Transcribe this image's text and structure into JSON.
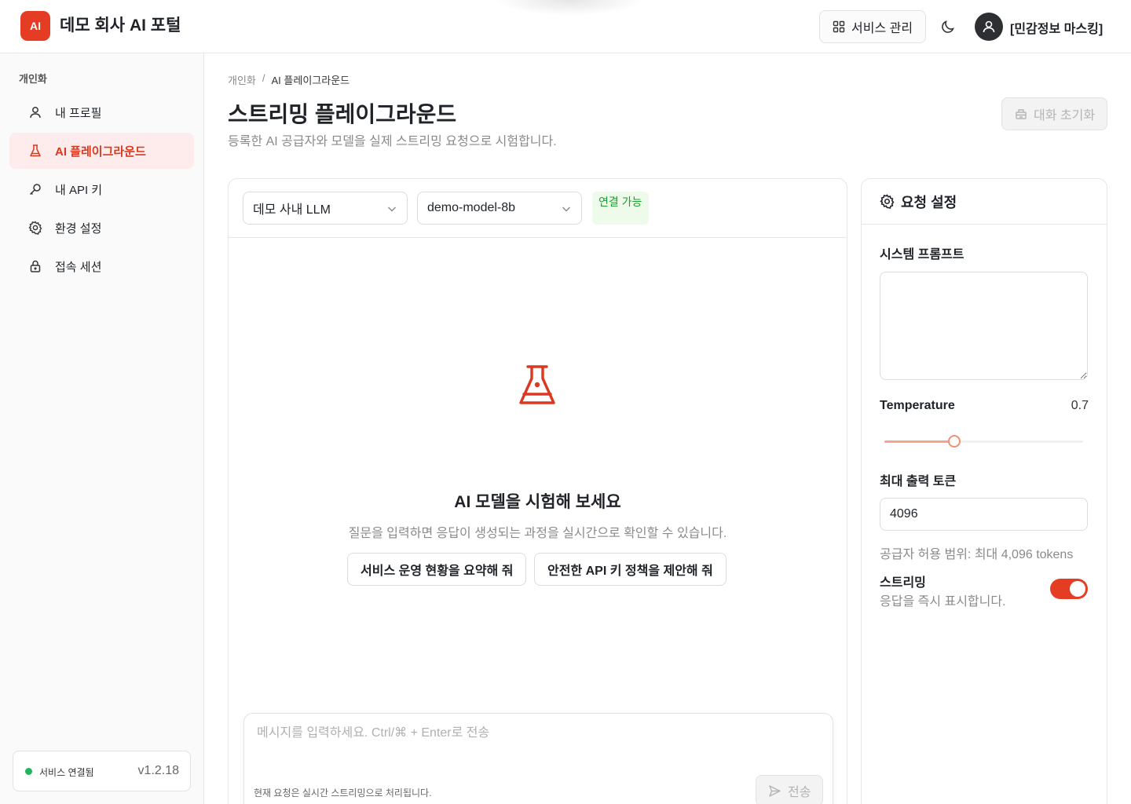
{
  "header": {
    "logo": "AI",
    "title": "데모 회사 AI 포털",
    "service_button": "서비스 관리",
    "user_name": "[민감정보 마스킹]"
  },
  "sidebar": {
    "section": "개인화",
    "items": [
      {
        "label": "내 프로필",
        "icon": "user-icon"
      },
      {
        "label": "AI 플레이그라운드",
        "icon": "flask-icon",
        "active": true
      },
      {
        "label": "내 API 키",
        "icon": "key-icon"
      },
      {
        "label": "환경 설정",
        "icon": "gear-icon"
      },
      {
        "label": "접속 세션",
        "icon": "lock-icon"
      }
    ],
    "status": {
      "label": "서비스 연결됨",
      "version": "v1.2.18",
      "color": "#22b35e"
    }
  },
  "main": {
    "breadcrumb": [
      "개인화",
      "AI 플레이그라운드"
    ],
    "title": "스트리밍 플레이그라운드",
    "subtitle": "등록한 AI 공급자와 모델을 실제 스트리밍 요청으로 시험합니다.",
    "reset_button": "대화 초기화"
  },
  "chat": {
    "provider": "데모 사내 LLM",
    "model": "demo-model-8b",
    "connection": "연결 가능",
    "empty_title": "AI 모델을 시험해 보세요",
    "empty_subtitle": "질문을 입력하면 응답이 생성되는 과정을 실시간으로 확인할 수 있습니다.",
    "suggestions": [
      "서비스 운영 현황을 요약해 줘",
      "안전한 API 키 정책을 제안해 줘"
    ],
    "input_placeholder": "메시지를 입력하세요. Ctrl/⌘ + Enter로 전송",
    "note": "현재 요청은 실시간 스트리밍으로 처리됩니다.",
    "send_button": "전송"
  },
  "settings": {
    "title": "요청 설정",
    "system_prompt_label": "시스템 프롬프트",
    "system_prompt_value": "",
    "temperature_label": "Temperature",
    "temperature_value": "0.7",
    "temperature_fraction": 0.35,
    "max_tokens_label": "최대 출력 토큰",
    "max_tokens_value": "4096",
    "max_tokens_hint": "공급자 허용 범위: 최대 4,096 tokens",
    "streaming_label": "스트리밍",
    "streaming_desc": "응답을 즉시 표시합니다.",
    "streaming_enabled": true
  },
  "colors": {
    "accent": "#e53d24",
    "active_bg": "#fdeceb",
    "success": "#1a9f2e"
  }
}
